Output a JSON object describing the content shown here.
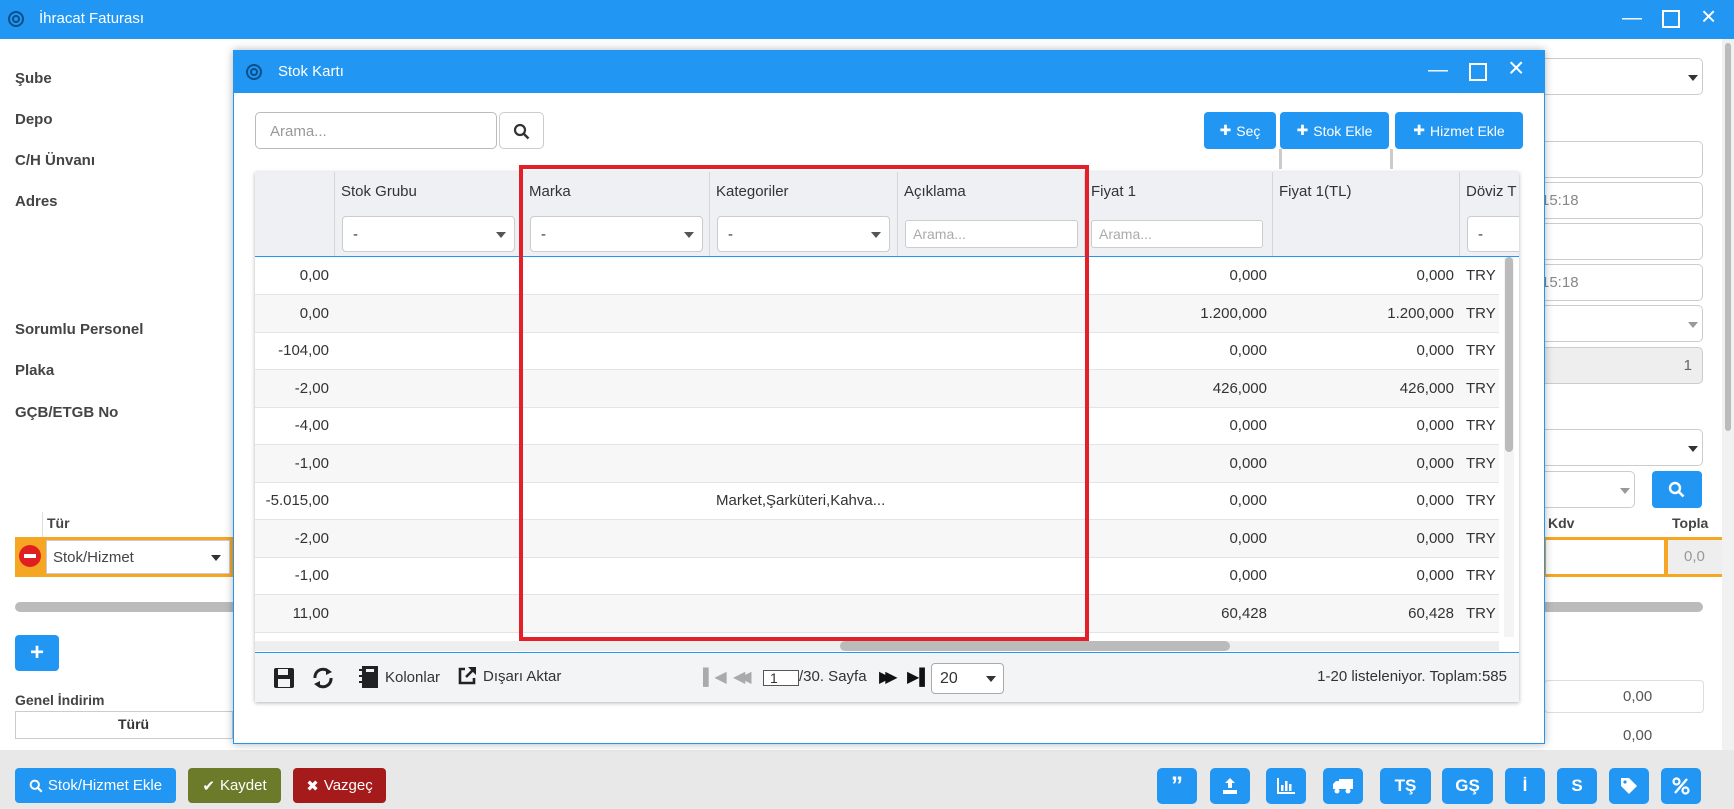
{
  "main_window": {
    "title": "İhracat Faturası"
  },
  "form": {
    "labels": {
      "sube": "Şube",
      "depo": "Depo",
      "ch_unvani": "C/H Ünvanı",
      "adres": "Adres",
      "sorumlu_personel": "Sorumlu Personel",
      "plaka": "Plaka",
      "gcb_etgb_no": "GÇB/ETGB No",
      "genel_indirim": "Genel İndirim"
    },
    "right_fields": {
      "time_1": "15:18",
      "time_2": "15:18",
      "number_value": "1"
    },
    "line_table": {
      "tur_header": "Tür",
      "tur_value": "Stok/Hizmet",
      "kdv_header": "Kdv",
      "toplam_header": "Topla",
      "toplam_value": "0,0"
    },
    "indirim_table": {
      "turu_header": "Türü"
    },
    "totals": [
      "0,00",
      "0,00"
    ]
  },
  "bottom_bar": {
    "stok_hizmet_ekle": "Stok/Hizmet Ekle",
    "kaydet": "Kaydet",
    "vazgec": "Vazgeç",
    "icon_buttons": [
      "quote",
      "upload",
      "chart",
      "truck",
      "TŞ",
      "GŞ",
      "İ",
      "S",
      "tag",
      "percent"
    ]
  },
  "modal": {
    "title": "Stok Kartı",
    "search_placeholder": "Arama...",
    "buttons": {
      "sec": "Seç",
      "stok_ekle": "Stok Ekle",
      "hizmet_ekle": "Hizmet Ekle"
    },
    "grid": {
      "columns": [
        "",
        "Stok Grubu",
        "Marka",
        "Kategoriler",
        "Açıklama",
        "Fiyat 1",
        "Fiyat 1(TL)",
        "Döviz T"
      ],
      "filters": {
        "stok_grubu": "-",
        "marka": "-",
        "kategoriler": "-",
        "aciklama_placeholder": "Arama...",
        "fiyat1_placeholder": "Arama...",
        "doviz": "-"
      },
      "rows": [
        {
          "miktar": "0,00",
          "kategori": "",
          "fiyat1": "0,000",
          "fiyat1tl": "0,000",
          "doviz": "TRY"
        },
        {
          "miktar": "0,00",
          "kategori": "",
          "fiyat1": "1.200,000",
          "fiyat1tl": "1.200,000",
          "doviz": "TRY"
        },
        {
          "miktar": "-104,00",
          "kategori": "",
          "fiyat1": "0,000",
          "fiyat1tl": "0,000",
          "doviz": "TRY"
        },
        {
          "miktar": "-2,00",
          "kategori": "",
          "fiyat1": "426,000",
          "fiyat1tl": "426,000",
          "doviz": "TRY"
        },
        {
          "miktar": "-4,00",
          "kategori": "",
          "fiyat1": "0,000",
          "fiyat1tl": "0,000",
          "doviz": "TRY"
        },
        {
          "miktar": "-1,00",
          "kategori": "",
          "fiyat1": "0,000",
          "fiyat1tl": "0,000",
          "doviz": "TRY"
        },
        {
          "miktar": "-5.015,00",
          "kategori": "Market,Şarküteri,Kahva...",
          "fiyat1": "0,000",
          "fiyat1tl": "0,000",
          "doviz": "TRY"
        },
        {
          "miktar": "-2,00",
          "kategori": "",
          "fiyat1": "0,000",
          "fiyat1tl": "0,000",
          "doviz": "TRY"
        },
        {
          "miktar": "-1,00",
          "kategori": "",
          "fiyat1": "0,000",
          "fiyat1tl": "0,000",
          "doviz": "TRY"
        },
        {
          "miktar": "11,00",
          "kategori": "",
          "fiyat1": "60,428",
          "fiyat1tl": "60,428",
          "doviz": "TRY"
        }
      ]
    },
    "pager": {
      "kolonlar": "Kolonlar",
      "disari_aktar": "Dışarı Aktar",
      "page": "1",
      "page_suffix": "/30. Sayfa",
      "page_size": "20",
      "summary": "1-20 listeleniyor. Toplam:585"
    },
    "highlight_color": "#e3202a"
  }
}
